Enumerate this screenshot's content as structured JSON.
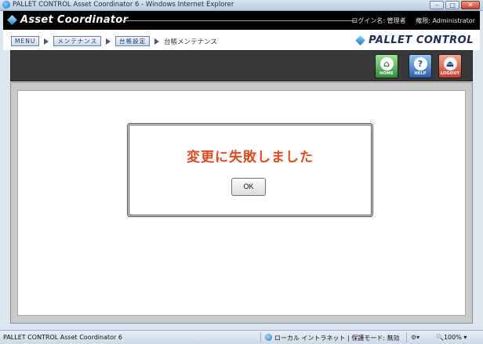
{
  "window": {
    "title": "PALLET CONTROL Asset Coordinator 6 - Windows Internet Explorer",
    "min_label": "–",
    "max_label": "□",
    "close_label": "✕"
  },
  "header": {
    "app_name": "Asset Coordinator",
    "login_label": "ログイン名: 管理者",
    "role_label": "権限: Administrator"
  },
  "breadcrumb": {
    "items": [
      "MENU",
      "メンテナンス",
      "台帳設定"
    ],
    "current": "台帳メンテナンス"
  },
  "brand": {
    "text": "PALLET CONTROL"
  },
  "toolbar": {
    "home_label": "HOME",
    "help_label": "HELP",
    "logout_label": "LOGOUT",
    "help_glyph": "?"
  },
  "dialog": {
    "message": "変更に失敗しました",
    "ok_label": "OK"
  },
  "statusbar": {
    "left_text": "PALLET CONTROL Asset Coordinator 6",
    "zone_text": "ローカル イントラネット | 保護モード: 無効",
    "zoom_text": "100%"
  }
}
